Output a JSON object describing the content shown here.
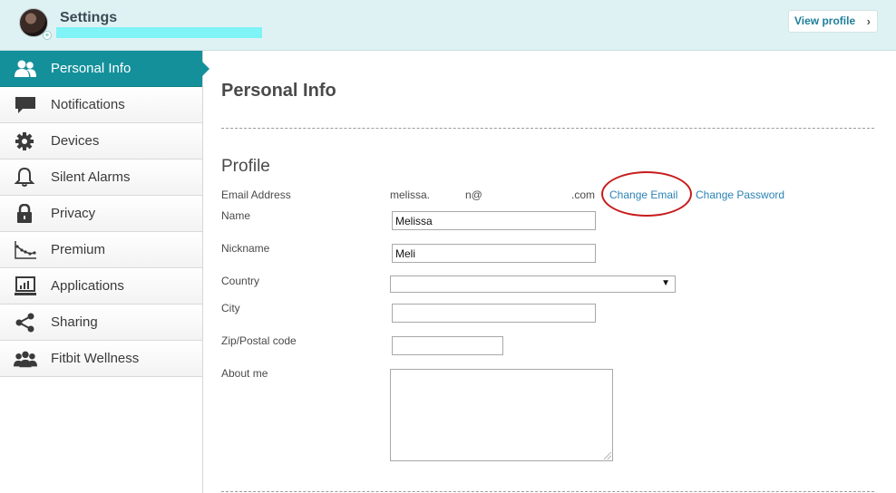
{
  "header": {
    "title": "Settings",
    "view_profile_label": "View profile",
    "view_profile_chevron": "›"
  },
  "sidebar": {
    "items": [
      {
        "label": "Personal Info",
        "icon": "people-icon",
        "active": true
      },
      {
        "label": "Notifications",
        "icon": "speech-bubble-icon"
      },
      {
        "label": "Devices",
        "icon": "gear-icon"
      },
      {
        "label": "Silent Alarms",
        "icon": "bell-icon"
      },
      {
        "label": "Privacy",
        "icon": "lock-icon"
      },
      {
        "label": "Premium",
        "icon": "chart-icon"
      },
      {
        "label": "Applications",
        "icon": "monitor-icon"
      },
      {
        "label": "Sharing",
        "icon": "share-icon"
      },
      {
        "label": "Fitbit Wellness",
        "icon": "group-icon"
      }
    ]
  },
  "main": {
    "page_title": "Personal Info",
    "section_title": "Profile",
    "email": {
      "label": "Email Address",
      "local_part": "melissa.",
      "at_fragment": "n@",
      "domain_end": ".com",
      "change_email_label": "Change Email",
      "change_password_label": "Change Password"
    },
    "fields": {
      "name_label": "Name",
      "name_value": "Melissa",
      "nickname_label": "Nickname",
      "nickname_value": "Meli",
      "country_label": "Country",
      "country_value": "",
      "city_label": "City",
      "city_value": "",
      "zip_label": "Zip/Postal code",
      "zip_value": "",
      "about_label": "About me",
      "about_value": ""
    },
    "select_arrow": "▼"
  },
  "colors": {
    "header_bg": "#dff2f3",
    "active_nav": "#14909b",
    "link": "#2a82b5",
    "annotation_circle": "#c81c1c",
    "redaction": "#7ff3f5"
  }
}
